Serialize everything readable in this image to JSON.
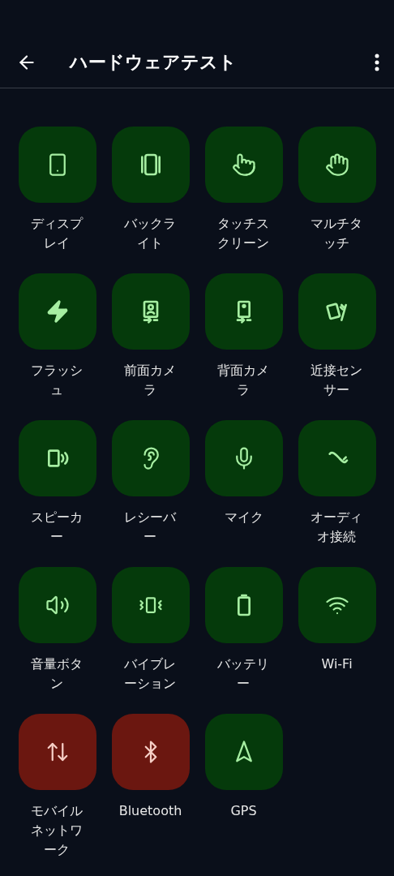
{
  "header": {
    "title": "ハードウェアテスト"
  },
  "tests": [
    {
      "label": "ディスプレイ",
      "failed": false
    },
    {
      "label": "バックライト",
      "failed": false
    },
    {
      "label": "タッチスクリーン",
      "failed": false
    },
    {
      "label": "マルチタッチ",
      "failed": false
    },
    {
      "label": "フラッシュ",
      "failed": false
    },
    {
      "label": "前面カメラ",
      "failed": false
    },
    {
      "label": "背面カメラ",
      "failed": false
    },
    {
      "label": "近接センサー",
      "failed": false
    },
    {
      "label": "スピーカー",
      "failed": false
    },
    {
      "label": "レシーバー",
      "failed": false
    },
    {
      "label": "マイク",
      "failed": false
    },
    {
      "label": "オーディオ接続",
      "failed": false
    },
    {
      "label": "音量ボタン",
      "failed": false
    },
    {
      "label": "バイブレーション",
      "failed": false
    },
    {
      "label": "バッテリー",
      "failed": false
    },
    {
      "label": "Wi-Fi",
      "failed": false
    },
    {
      "label": "モバイルネットワーク",
      "failed": true
    },
    {
      "label": "Bluetooth",
      "failed": true
    },
    {
      "label": "GPS",
      "failed": false
    }
  ]
}
